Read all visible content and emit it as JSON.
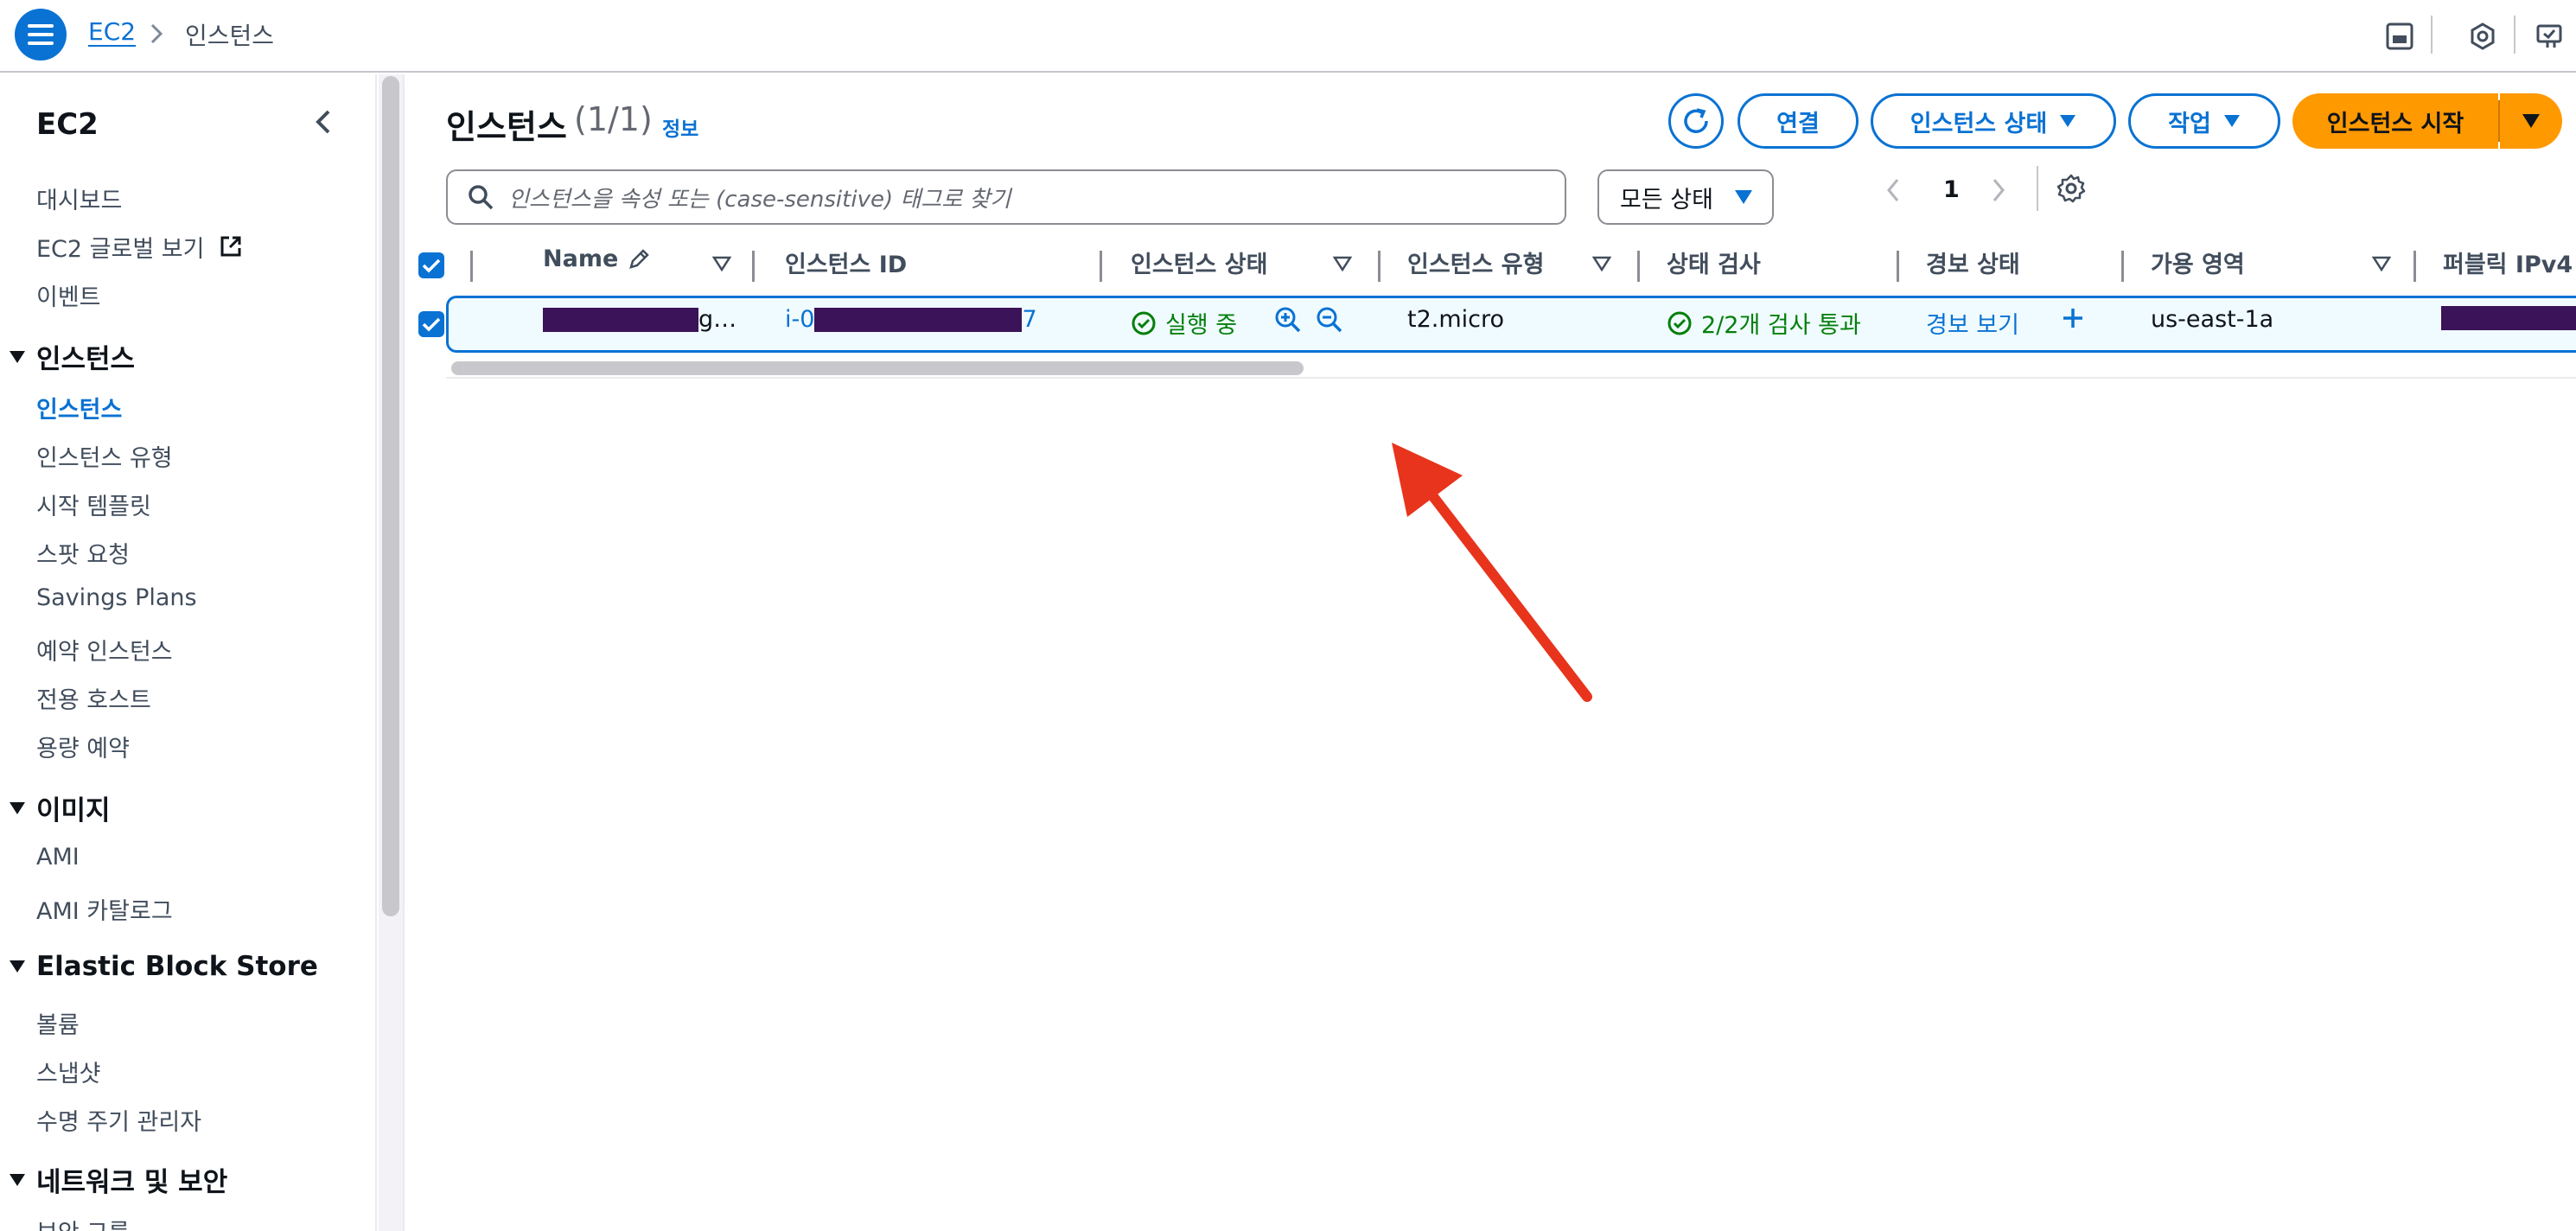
{
  "topbar": {
    "breadcrumb_root": "EC2",
    "breadcrumb_current": "인스턴스"
  },
  "sidebar": {
    "title": "EC2",
    "items_top": [
      {
        "label": "대시보드"
      },
      {
        "label": "EC2 글로벌 보기"
      },
      {
        "label": "이벤트"
      }
    ],
    "sections": [
      {
        "label": "인스턴스",
        "items": [
          "인스턴스",
          "인스턴스 유형",
          "시작 템플릿",
          "스팟 요청",
          "Savings Plans",
          "예약 인스턴스",
          "전용 호스트",
          "용량 예약"
        ]
      },
      {
        "label": "이미지",
        "items": [
          "AMI",
          "AMI 카탈로그"
        ]
      },
      {
        "label": "Elastic Block Store",
        "items": [
          "볼륨",
          "스냅샷",
          "수명 주기 관리자"
        ]
      },
      {
        "label": "네트워크 및 보안",
        "items": [
          "보안 그룹"
        ]
      }
    ],
    "active_item": "인스턴스"
  },
  "header": {
    "title": "인스턴스",
    "count": "(1/1)",
    "info": "정보",
    "connect_label": "연결",
    "instance_state_label": "인스턴스 상태",
    "actions_label": "작업",
    "launch_label": "인스턴스 시작"
  },
  "search": {
    "placeholder": "인스턴스을 속성 또는 (case-sensitive) 태그로 찾기"
  },
  "filter": {
    "state_label": "모든 상태"
  },
  "pagination": {
    "current_page": "1"
  },
  "table": {
    "columns": [
      "Name",
      "인스턴스 ID",
      "인스턴스 상태",
      "인스턴스 유형",
      "상태 검사",
      "경보 상태",
      "가용 영역",
      "퍼블릭 IPv4"
    ],
    "rows": [
      {
        "name_suffix": "g…",
        "id_prefix": "i-0",
        "id_suffix": "7",
        "state": "실행 중",
        "type": "t2.micro",
        "status_check": "2/2개 검사 통과",
        "alarm": "경보 보기",
        "zone": "us-east-1a",
        "selected": true
      }
    ]
  },
  "colors": {
    "accent": "#0972d3",
    "primary_button": "#ff9900",
    "success": "#037f0c",
    "redaction": "#3b1359",
    "annotation_arrow": "#e8341c"
  }
}
